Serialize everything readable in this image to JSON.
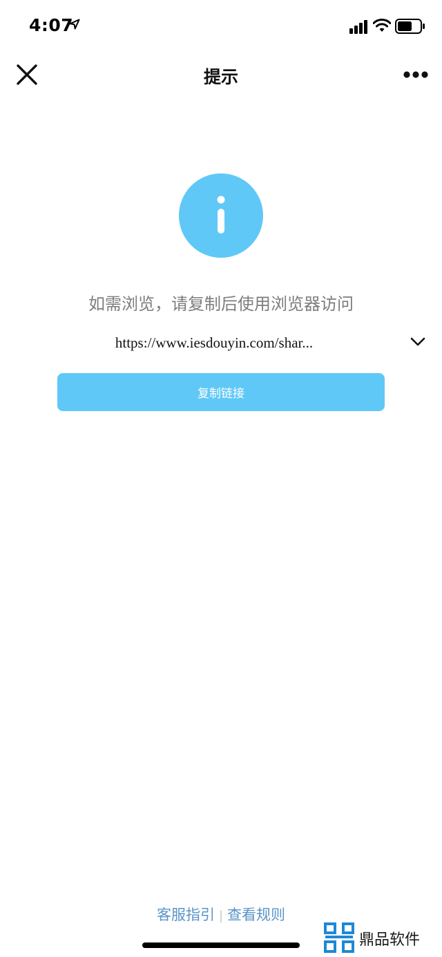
{
  "status_bar": {
    "time": "4:07"
  },
  "nav": {
    "title": "提示"
  },
  "main": {
    "message": "如需浏览，请复制后使用浏览器访问",
    "url": "https://www.iesdouyin.com/shar...",
    "copy_button_label": "复制链接"
  },
  "footer": {
    "links": [
      {
        "label": "客服指引"
      },
      {
        "label": "查看规则"
      }
    ],
    "separator": "|"
  },
  "watermark": {
    "text": "鼎品软件"
  },
  "colors": {
    "accent": "#5fc8f6",
    "link": "#5a94c8",
    "message_text": "#7d7d7d"
  }
}
